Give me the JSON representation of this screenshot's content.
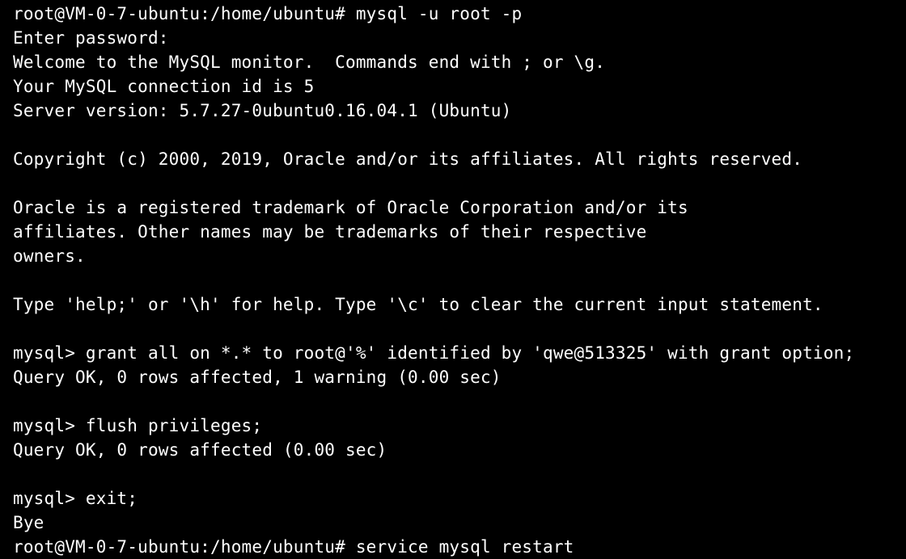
{
  "terminal": {
    "background": "#000000",
    "foreground": "#ffffff",
    "lines": [
      "root@VM-0-7-ubuntu:/home/ubuntu# mysql -u root -p",
      "Enter password:",
      "Welcome to the MySQL monitor.  Commands end with ; or \\g.",
      "Your MySQL connection id is 5",
      "Server version: 5.7.27-0ubuntu0.16.04.1 (Ubuntu)",
      "",
      "Copyright (c) 2000, 2019, Oracle and/or its affiliates. All rights reserved.",
      "",
      "Oracle is a registered trademark of Oracle Corporation and/or its",
      "affiliates. Other names may be trademarks of their respective",
      "owners.",
      "",
      "Type 'help;' or '\\h' for help. Type '\\c' to clear the current input statement.",
      "",
      "mysql> grant all on *.* to root@'%' identified by 'qwe@513325' with grant option;",
      "Query OK, 0 rows affected, 1 warning (0.00 sec)",
      "",
      "mysql> flush privileges;",
      "Query OK, 0 rows affected (0.00 sec)",
      "",
      "mysql> exit;",
      "Bye",
      "root@VM-0-7-ubuntu:/home/ubuntu# service mysql restart"
    ]
  }
}
